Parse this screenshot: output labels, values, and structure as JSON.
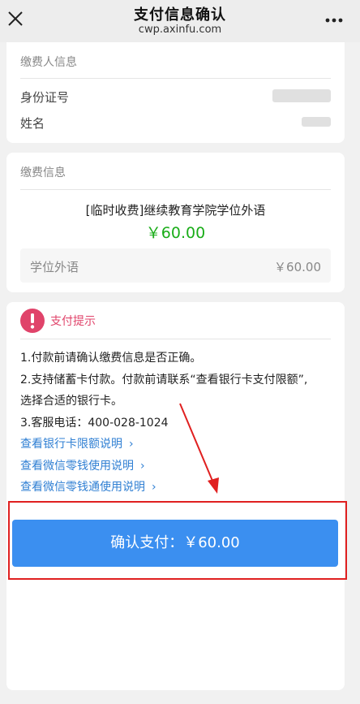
{
  "header": {
    "close_icon": "close-icon",
    "title": "支付信息确认",
    "url": "cwp.axinfu.com",
    "more_icon": "more-icon"
  },
  "payer": {
    "section_title": "缴费人信息",
    "id_label": "身份证号",
    "name_label": "姓名"
  },
  "fee": {
    "section_title": "缴费信息",
    "item_name": "[临时收费]继续教育学院学位外语",
    "amount": "￥60.00",
    "detail_label": "学位外语",
    "detail_amount": "￥60.00"
  },
  "tips": {
    "icon": "warning-icon",
    "title": "支付提示",
    "line1": "1.付款前请确认缴费信息是否正确。",
    "line2a": "2.支持储蓄卡付款。付款前请联系“查看银行卡支付限额”,",
    "line2b": "选择合适的银行卡。",
    "line3": "3.客服电话：400-028-1024",
    "links": [
      "查看银行卡限额说明",
      "查看微信零钱使用说明",
      "查看微信零钱通使用说明"
    ]
  },
  "pay_button": "确认支付：￥60.00",
  "colors": {
    "accent_blue": "#3b8ff0",
    "amount_green": "#1aad19",
    "tip_pink": "#e0436a",
    "annotation_red": "#e02020"
  }
}
